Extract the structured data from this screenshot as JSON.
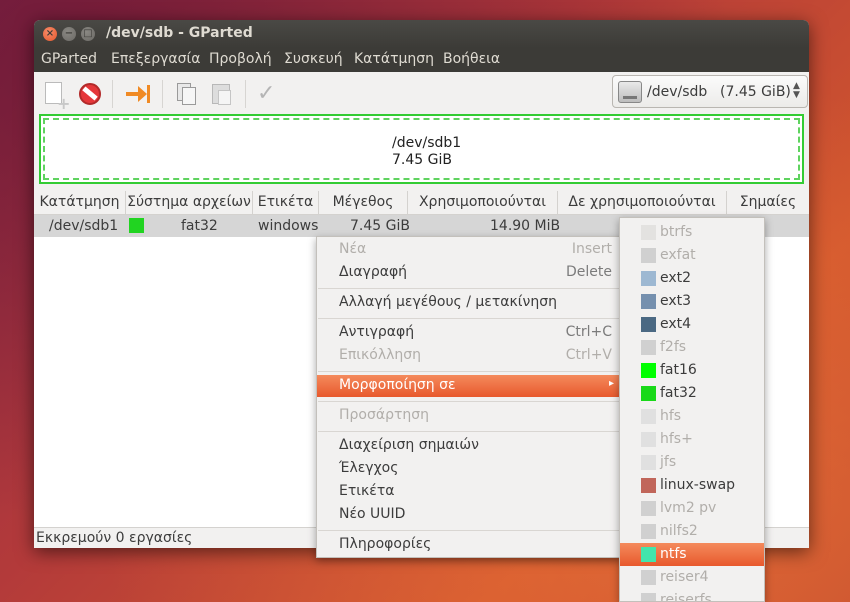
{
  "window": {
    "title": "/dev/sdb - GParted",
    "controls": {
      "close": "×",
      "minimize": "−",
      "maximize": "□"
    }
  },
  "menubar": [
    "GParted",
    "Επεξεργασία",
    "Προβολή",
    "Συσκευή",
    "Κατάτμηση",
    "Βοήθεια"
  ],
  "toolbar": {
    "icons": [
      "new-icon",
      "delete-icon",
      "resize-move-icon",
      "copy-icon",
      "paste-icon",
      "apply-icon"
    ],
    "device": {
      "name": "/dev/sdb",
      "size": "(7.45 GiB)",
      "arrows": "▲\n▼"
    }
  },
  "partition_map": {
    "name": "/dev/sdb1",
    "size": "7.45 GiB",
    "color": "#33cc33"
  },
  "table": {
    "headers": [
      "Κατάτμηση",
      "Σύστημα αρχείων",
      "Ετικέτα",
      "Μέγεθος",
      "Χρησιμοποιούνται",
      "Δε χρησιμοποιούνται",
      "Σημαίες"
    ],
    "rows": [
      {
        "partition": "/dev/sdb1",
        "filesystem": "fat32",
        "fs_color": "#21d421",
        "label": "windows",
        "size": "7.45 GiB",
        "used": "14.90 MiB",
        "unused": "",
        "flags": ""
      }
    ]
  },
  "status": {
    "text": "Εκκρεμούν 0 εργασίες"
  },
  "context_menu": {
    "items": [
      {
        "label": "Νέα",
        "accel": "Insert",
        "disabled": true
      },
      {
        "label": "Διαγραφή",
        "accel": "Delete",
        "disabled": false
      },
      {
        "label": "Αλλαγή μεγέθους / μετακίνηση",
        "accel": "",
        "disabled": false
      },
      {
        "label": "Αντιγραφή",
        "accel": "Ctrl+C",
        "disabled": false
      },
      {
        "label": "Επικόλληση",
        "accel": "Ctrl+V",
        "disabled": true
      },
      {
        "label": "Μορφοποίηση σε",
        "accel": "",
        "disabled": false,
        "submenu": true,
        "arrow": "▸"
      },
      {
        "label": "Προσάρτηση",
        "accel": "",
        "disabled": true
      },
      {
        "label": "Διαχείριση σημαιών",
        "accel": "",
        "disabled": false
      },
      {
        "label": "Έλεγχος",
        "accel": "",
        "disabled": false
      },
      {
        "label": "Ετικέτα",
        "accel": "",
        "disabled": false
      },
      {
        "label": "Νέο UUID",
        "accel": "",
        "disabled": false
      },
      {
        "label": "Πληροφορίες",
        "accel": "",
        "disabled": false
      }
    ]
  },
  "format_submenu": {
    "items": [
      {
        "label": "btrfs",
        "color": "#e3e2e0",
        "disabled": true
      },
      {
        "label": "exfat",
        "color": "#d0d0d0",
        "disabled": true
      },
      {
        "label": "ext2",
        "color": "#9db8d2",
        "disabled": false
      },
      {
        "label": "ext3",
        "color": "#7590ae",
        "disabled": false
      },
      {
        "label": "ext4",
        "color": "#4b6983",
        "disabled": false
      },
      {
        "label": "f2fs",
        "color": "#d0d0d0",
        "disabled": true
      },
      {
        "label": "fat16",
        "color": "#00ff00",
        "disabled": false
      },
      {
        "label": "fat32",
        "color": "#18d918",
        "disabled": false
      },
      {
        "label": "hfs",
        "color": "#e0e0e0",
        "disabled": true
      },
      {
        "label": "hfs+",
        "color": "#e0e0e0",
        "disabled": true
      },
      {
        "label": "jfs",
        "color": "#e0e0e0",
        "disabled": true
      },
      {
        "label": "linux-swap",
        "color": "#c1665a",
        "disabled": false
      },
      {
        "label": "lvm2 pv",
        "color": "#d0d0d0",
        "disabled": true
      },
      {
        "label": "nilfs2",
        "color": "#d0d0d0",
        "disabled": true
      },
      {
        "label": "ntfs",
        "color": "#42e5ac",
        "disabled": false
      },
      {
        "label": "reiser4",
        "color": "#d0d0d0",
        "disabled": true
      },
      {
        "label": "reiserfs",
        "color": "#d0d0d0",
        "disabled": true
      }
    ]
  },
  "colors": {
    "accent": "#e8592d",
    "titlebar": "#3c3b37",
    "close_button": "#e3572b"
  }
}
